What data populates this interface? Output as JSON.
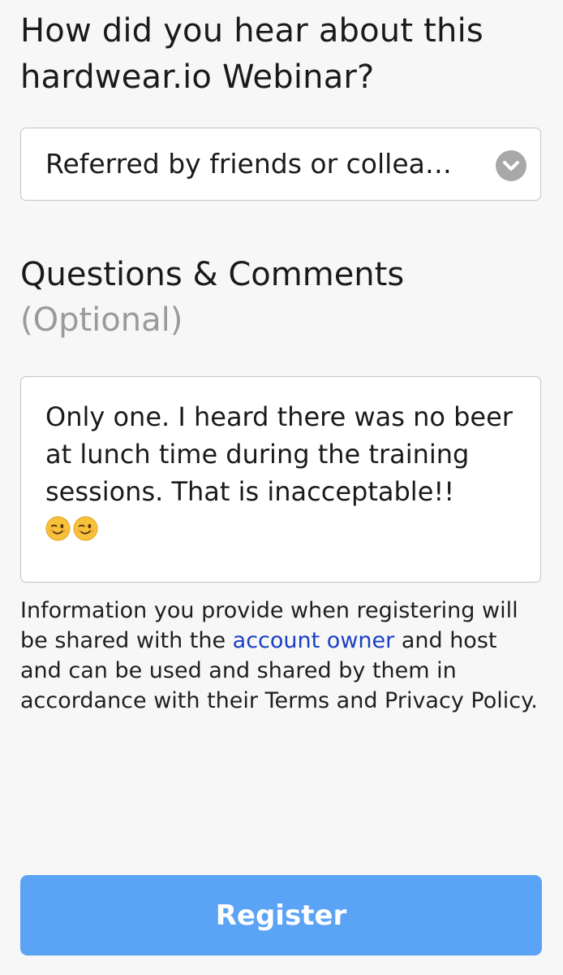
{
  "form": {
    "referral_question": "How did you hear about this hardwear.io Webinar?",
    "referral_selected": "Referred by friends or collea…",
    "comments_heading": "Questions & Comments",
    "comments_optional": "(Optional)",
    "comments_value_text": "Only one. I heard there was no beer at lunch time during the training sessions. That is inacceptable!!",
    "comments_emoji": [
      "winking-face",
      "winking-face"
    ],
    "disclaimer_before_link": "Information you provide when registering will be shared with the ",
    "disclaimer_link": "account owner",
    "disclaimer_after_link": " and host and can be used and shared by them in accordance with their Terms and Privacy Policy.",
    "register_label": "Register"
  },
  "colors": {
    "background": "#f7f7f7",
    "button": "#5ba3f5",
    "link": "#1a3fc4",
    "muted_text": "#9a9a9a"
  }
}
